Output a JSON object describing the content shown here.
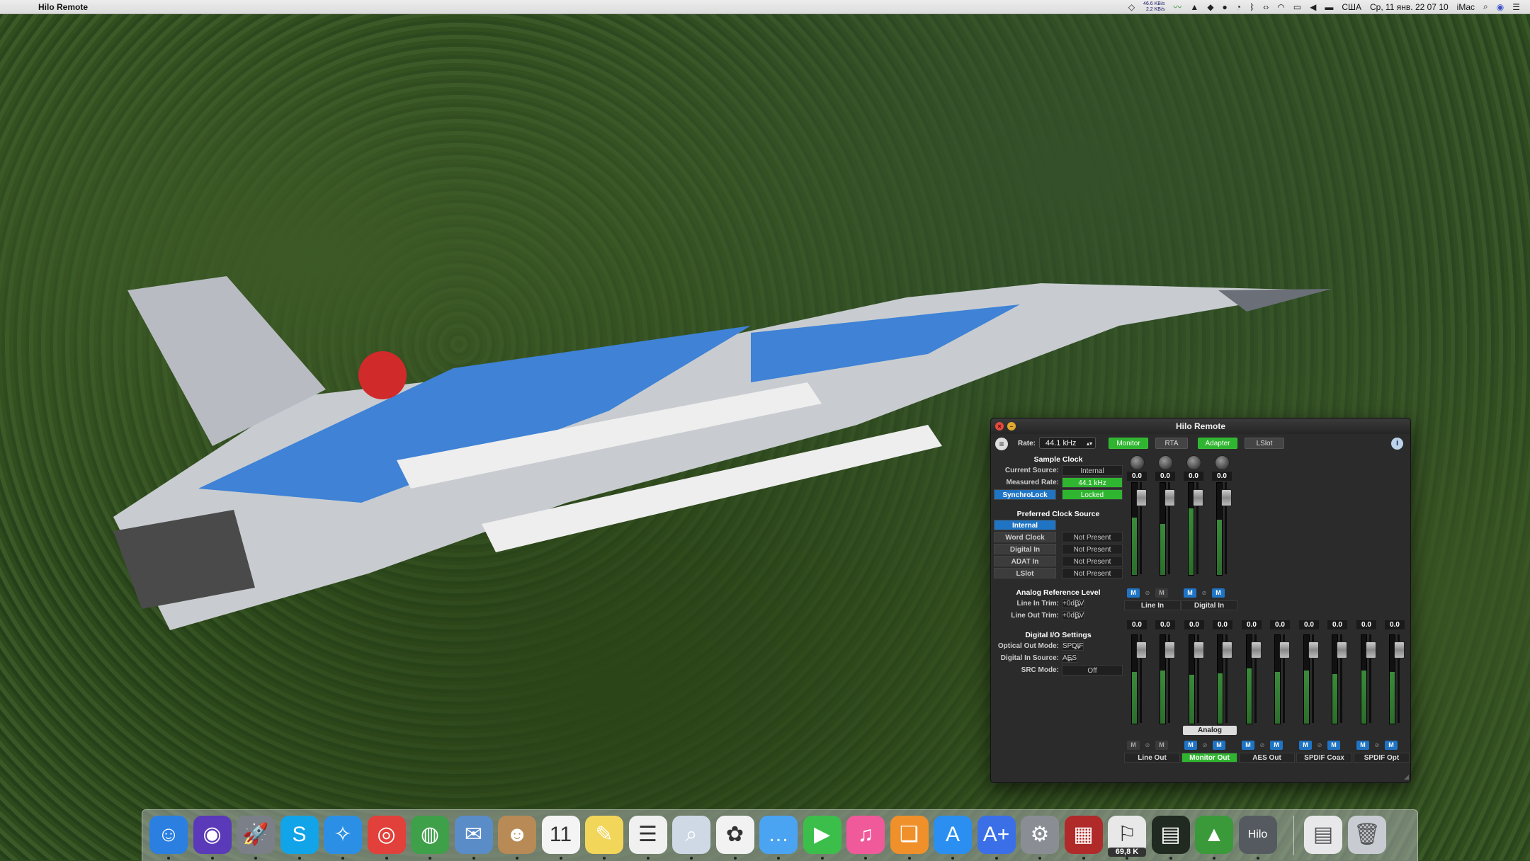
{
  "menubar": {
    "app_name": "Hilo Remote",
    "net_up": "46.6 KB/s",
    "net_down": "2.2 KB/s",
    "input_source": "США",
    "datetime": "Ср, 11 янв.  22 07 10",
    "computer_name": "iMac"
  },
  "hilo": {
    "title": "Hilo Remote",
    "rate_label": "Rate:",
    "rate_value": "44.1 kHz",
    "tabs": [
      {
        "label": "Monitor",
        "active": true
      },
      {
        "label": "RTA",
        "active": false
      },
      {
        "label": "Adapter",
        "active": true
      },
      {
        "label": "LSlot",
        "active": false
      }
    ],
    "sample_clock": {
      "title": "Sample Clock",
      "current_source_label": "Current Source:",
      "current_source_value": "Internal",
      "measured_rate_label": "Measured Rate:",
      "measured_rate_value": "44.1 kHz",
      "synchrolock_label": "SynchroLock",
      "synchrolock_value": "Locked"
    },
    "preferred_clock": {
      "title": "Preferred Clock Source",
      "items": [
        {
          "label": "Internal",
          "status": "",
          "selected": true
        },
        {
          "label": "Word Clock",
          "status": "Not Present",
          "selected": false
        },
        {
          "label": "Digital In",
          "status": "Not Present",
          "selected": false
        },
        {
          "label": "ADAT In",
          "status": "Not Present",
          "selected": false
        },
        {
          "label": "LSlot",
          "status": "Not Present",
          "selected": false
        }
      ]
    },
    "analog_ref": {
      "title": "Analog Reference Level",
      "line_in_label": "Line In Trim:",
      "line_in_value": "+0dBV",
      "line_out_label": "Line Out Trim:",
      "line_out_value": "+0dBV"
    },
    "digital_io": {
      "title": "Digital I/O Settings",
      "optical_label": "Optical Out Mode:",
      "optical_value": "SPDIF",
      "digital_in_label": "Digital In Source:",
      "digital_in_value": "AES",
      "src_label": "SRC Mode:",
      "src_value": "Off"
    },
    "mixer": {
      "inputs": {
        "values": [
          "0.0",
          "0.0",
          "0.0",
          "0.0"
        ],
        "levels": [
          0.62,
          0.55,
          0.72,
          0.6
        ],
        "mute_label": "M",
        "groups": [
          {
            "label": "Line In",
            "active": false
          },
          {
            "label": "Digital In",
            "active": false
          }
        ]
      },
      "outputs": {
        "values": [
          "0.0",
          "0.0",
          "0.0",
          "0.0",
          "0.0",
          "0.0",
          "0.0",
          "0.0",
          "0.0",
          "0.0"
        ],
        "levels": [
          0.58,
          0.6,
          0.55,
          0.57,
          0.62,
          0.58,
          0.6,
          0.56,
          0.6,
          0.58
        ],
        "mute_label": "M",
        "analog_label": "Analog",
        "groups": [
          {
            "label": "Line Out",
            "active": false
          },
          {
            "label": "Monitor Out",
            "active": true
          },
          {
            "label": "AES Out",
            "active": false
          },
          {
            "label": "SPDIF Coax",
            "active": false
          },
          {
            "label": "SPDIF Opt",
            "active": false
          }
        ]
      }
    }
  },
  "dock": {
    "items": [
      {
        "name": "finder",
        "glyph": "☺",
        "color": "#2a7fe0"
      },
      {
        "name": "siri",
        "glyph": "◉",
        "color": "#5a3ab8"
      },
      {
        "name": "launchpad",
        "glyph": "🚀",
        "color": "#7a7f88"
      },
      {
        "name": "skype",
        "glyph": "S",
        "color": "#12a4e8"
      },
      {
        "name": "safari",
        "glyph": "✧",
        "color": "#2b8fe6"
      },
      {
        "name": "chrome",
        "glyph": "◎",
        "color": "#e2403a"
      },
      {
        "name": "globe-app",
        "glyph": "◍",
        "color": "#3fa04a"
      },
      {
        "name": "mail-bird",
        "glyph": "✉",
        "color": "#5a8cc8"
      },
      {
        "name": "contacts",
        "glyph": "☻",
        "color": "#b88a55"
      },
      {
        "name": "calendar",
        "glyph": "11",
        "color": "#f4f4f4"
      },
      {
        "name": "notes",
        "glyph": "✎",
        "color": "#f2d65a"
      },
      {
        "name": "reminders",
        "glyph": "☰",
        "color": "#f0f0f0"
      },
      {
        "name": "preview",
        "glyph": "⌕",
        "color": "#cfd9e6"
      },
      {
        "name": "photos",
        "glyph": "✿",
        "color": "#f2f2f2"
      },
      {
        "name": "messages",
        "glyph": "…",
        "color": "#4aa4f2"
      },
      {
        "name": "facetime",
        "glyph": "▶",
        "color": "#3bbf4a"
      },
      {
        "name": "itunes",
        "glyph": "♫",
        "color": "#f05a9a"
      },
      {
        "name": "ibooks",
        "glyph": "❑",
        "color": "#f0902a"
      },
      {
        "name": "app-store",
        "glyph": "A",
        "color": "#2a8ff0"
      },
      {
        "name": "app-store-alt",
        "glyph": "A+",
        "color": "#3a6fe8"
      },
      {
        "name": "system-preferences",
        "glyph": "⚙",
        "color": "#8a8e94"
      },
      {
        "name": "photo-booth",
        "glyph": "▦",
        "color": "#b02a2a"
      },
      {
        "name": "disk-utility",
        "glyph": "⚐",
        "color": "#e8e8e8",
        "badge": "69,8 K"
      },
      {
        "name": "activity-monitor",
        "glyph": "▤",
        "color": "#202a20"
      },
      {
        "name": "mountain-app",
        "glyph": "▲",
        "color": "#3a9a3a"
      },
      {
        "name": "hilo-remote",
        "glyph": "Hilo",
        "color": "#555a60"
      }
    ],
    "trailing": [
      {
        "name": "downloads-stack",
        "glyph": "▤",
        "color": "#e8e8ea"
      },
      {
        "name": "trash",
        "glyph": "🗑",
        "color": "#c8ccd2"
      }
    ]
  }
}
